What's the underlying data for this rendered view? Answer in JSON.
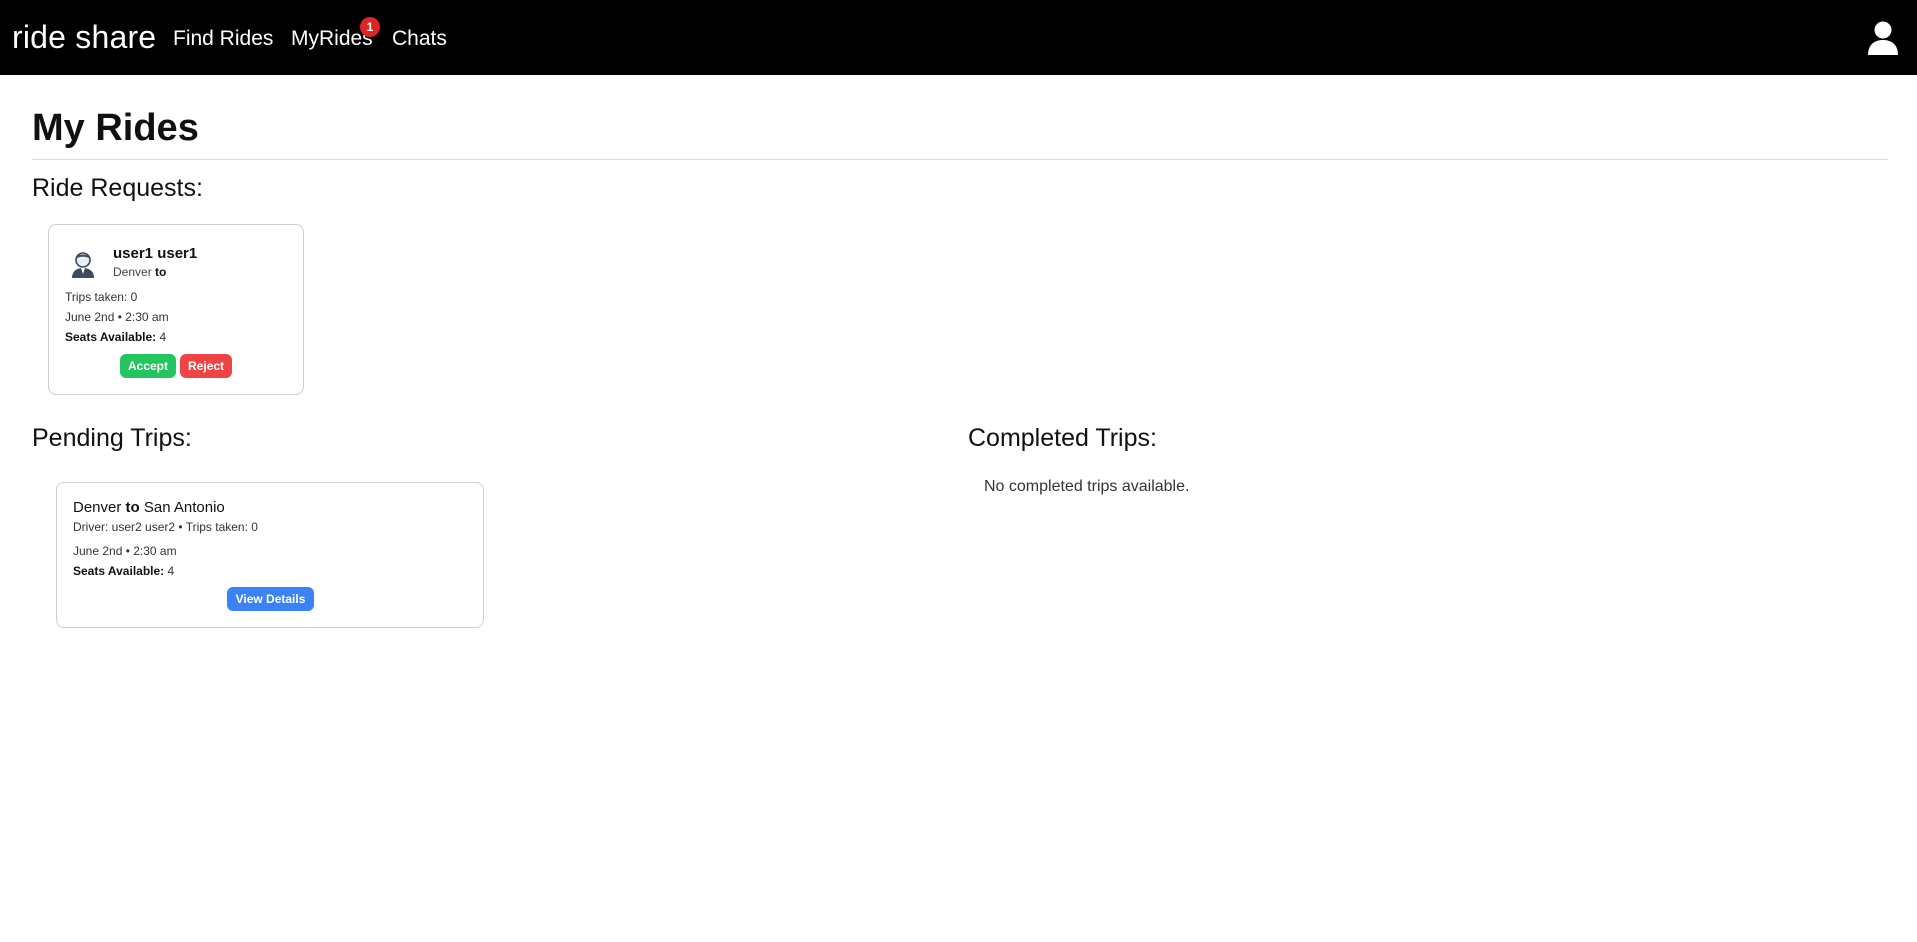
{
  "navbar": {
    "brand": "ride share",
    "links": [
      "Find Rides",
      "MyRides",
      "Chats"
    ],
    "myrides_badge": "1",
    "profile_icon": "user-icon"
  },
  "page": {
    "title": "My Rides"
  },
  "ride_requests": {
    "heading": "Ride Requests:",
    "items": [
      {
        "name": "user1 user1",
        "from": "Denver",
        "to_word": "to",
        "to": "",
        "trips_taken": "Trips taken: 0",
        "datetime": "June 2nd • 2:30 am",
        "seats_label": "Seats Available:",
        "seats": "4",
        "accept_label": "Accept",
        "reject_label": "Reject"
      }
    ]
  },
  "pending_trips": {
    "heading": "Pending Trips:",
    "items": [
      {
        "from": "Denver",
        "to_word": "to",
        "to": "San Antonio",
        "driver_line": "Driver: user2 user2 • Trips taken: 0",
        "datetime": "June 2nd • 2:30 am",
        "seats_label": "Seats Available:",
        "seats": "4",
        "details_label": "View Details"
      }
    ]
  },
  "completed_trips": {
    "heading": "Completed Trips:",
    "empty_text": "No completed trips available."
  },
  "colors": {
    "navbar": "#000000",
    "accept": "#22c55e",
    "reject": "#ef4444",
    "details": "#3b82f6",
    "badge": "#dc2626"
  }
}
